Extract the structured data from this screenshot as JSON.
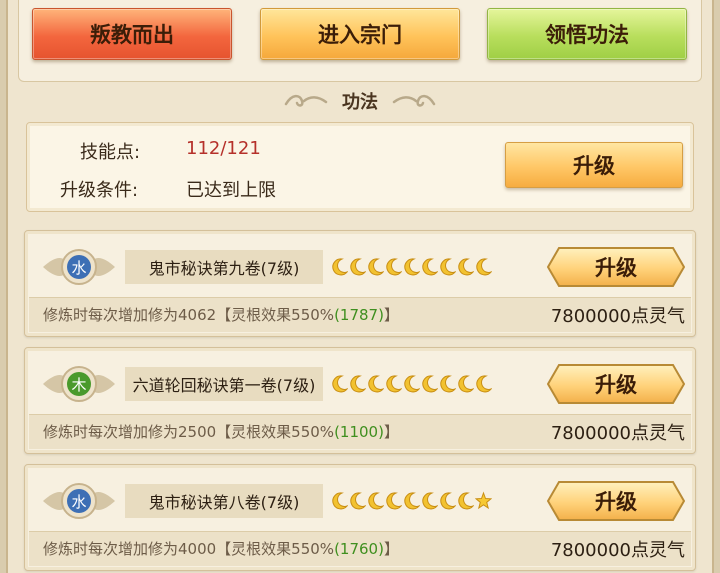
{
  "top_buttons": {
    "rebel_label": "叛教而出",
    "enter_sect_label": "进入宗门",
    "comprehend_label": "领悟功法"
  },
  "section": {
    "title": "功法"
  },
  "skill_points": {
    "label": "技能点:",
    "value": "112/121",
    "condition_label": "升级条件:",
    "condition_value": "已达到上限",
    "upgrade_label": "升级"
  },
  "colors": {
    "skill_value": "#b5302a",
    "bonus_green": "#3f8f1f",
    "water_badge": "#3d6fb5",
    "wood_badge": "#4a9a2c"
  },
  "techniques": [
    {
      "element": "水",
      "element_icon": "water-element-icon",
      "name": "鬼市秘诀第九卷(7级)",
      "moons": 9,
      "stars": 0,
      "upgrade_label": "升级",
      "desc_prefix": "修炼时每次增加修为4062【灵根效果550%",
      "desc_bonus": "(1787)",
      "desc_suffix": "】",
      "cost": "7800000点灵气"
    },
    {
      "element": "木",
      "element_icon": "wood-element-icon",
      "name": "六道轮回秘诀第一卷(7级)",
      "moons": 9,
      "stars": 0,
      "upgrade_label": "升级",
      "desc_prefix": "修炼时每次增加修为2500【灵根效果550%",
      "desc_bonus": "(1100)",
      "desc_suffix": "】",
      "cost": "7800000点灵气"
    },
    {
      "element": "水",
      "element_icon": "water-element-icon",
      "name": "鬼市秘诀第八卷(7级)",
      "moons": 8,
      "stars": 1,
      "upgrade_label": "升级",
      "desc_prefix": "修炼时每次增加修为4000【灵根效果550%",
      "desc_bonus": "(1760)",
      "desc_suffix": "】",
      "cost": "7800000点灵气"
    }
  ]
}
